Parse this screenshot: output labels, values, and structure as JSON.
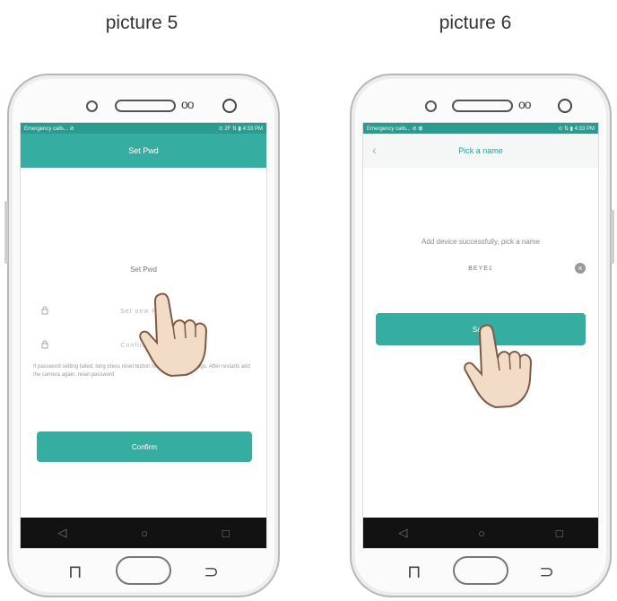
{
  "captions": {
    "left": "picture 5",
    "right": "picture 6"
  },
  "colors": {
    "accent": "#35ada0",
    "status": "#2a9b8e",
    "navbar": "#121212"
  },
  "left_phone": {
    "status_left": "Emergency calls... ⊘",
    "status_right": "⊙ 2F ⇅ ▮ 4:33 PM",
    "appbar_title": "Set Pwd",
    "section_title": "Set Pwd",
    "field1_placeholder": "Set new Pwd",
    "field2_placeholder": "Confirm Pwd",
    "hint": "If password setting failed, long press reset button restore factory settings. After restarts add the camera again, reset password",
    "confirm_button": "Confirm",
    "nav_back": "◁",
    "nav_home": "○",
    "nav_recent": "□"
  },
  "right_phone": {
    "status_left": "Emergency calls... ⊘ ⊠",
    "status_right": "⊙ ⇅ ▮ 4:33 PM",
    "appbar_title": "Pick a name",
    "message": "Add device successfully, pick a name",
    "name_value": "BEYE1",
    "save_button": "Save",
    "nav_back": "◁",
    "nav_home": "○",
    "nav_recent": "□"
  },
  "icons": {
    "back": "chevron-left-icon",
    "lock": "lock-icon",
    "clear": "clear-icon",
    "pointer": "pointing-hand-icon"
  }
}
